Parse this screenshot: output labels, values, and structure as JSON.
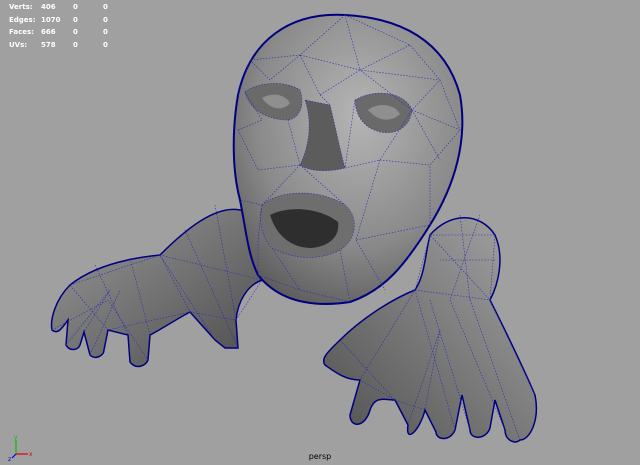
{
  "hud": {
    "rows": [
      {
        "label": "Verts:",
        "values": [
          "406",
          "0",
          "0"
        ]
      },
      {
        "label": "Edges:",
        "values": [
          "1070",
          "0",
          "0"
        ]
      },
      {
        "label": "Faces:",
        "values": [
          "666",
          "0",
          "0"
        ]
      },
      {
        "label": "UVs:",
        "values": [
          "578",
          "0",
          "0"
        ]
      }
    ]
  },
  "camera": "persp",
  "axis": {
    "x": "x",
    "y": "y",
    "z": "z"
  },
  "colors": {
    "background": "#a0a0a0",
    "mesh_fill": "#7b7b7b",
    "mesh_shadow": "#3e3e3e",
    "wire": "#1a1a9c",
    "silhouette": "#000080"
  },
  "icons": [
    "axis-gizmo-icon"
  ]
}
